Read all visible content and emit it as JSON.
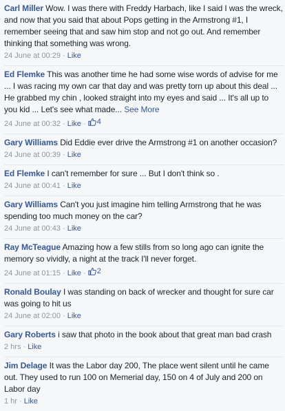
{
  "comments": [
    {
      "author": "Carl Miller",
      "text": "Wow. I was there with Freddy Harbach, like I said I was the wreck, and now that you said that about Pops getting in the Armstrong #1, I remember seeing that and saw him stop and not go out. And remember thinking that something was wrong.",
      "time": "24 June at 00:29",
      "like_label": "Like"
    },
    {
      "author": "Ed Flemke",
      "text": "This was another time he had some wise words of advise for me ... I was racing my own car that day and was pretty torn up about this deal ... He grabbed my chin , looked straight into my eyes and said ... It's all up to you kid ... Let's see what made...",
      "see_more": "See More",
      "time": "24 June at 00:32",
      "like_label": "Like",
      "likes": "4"
    },
    {
      "author": "Gary Williams",
      "text": "Did Eddie ever drive the Armstrong #1 on another occasion?",
      "time": "24 June at 00:39",
      "like_label": "Like"
    },
    {
      "author": "Ed Flemke",
      "text": "I can't remember for sure ... But I don't think so .",
      "time": "24 June at 00:41",
      "like_label": "Like"
    },
    {
      "author": "Gary Williams",
      "text": "Can't you just imagine him telling Armstrong that he was spending too much money on the car?",
      "time": "24 June at 00:43",
      "like_label": "Like"
    },
    {
      "author": "Ray McTeague",
      "text": "Amazing how a few stills from so long ago can ignite the memory so vividly, a night at the track I'll never forget.",
      "time": "24 June at 01:15",
      "like_label": "Like",
      "likes": "2"
    },
    {
      "author": "Ronald Boulay",
      "text": "I was standing on back of wrecker and thought for sure car was going to hit us",
      "time": "24 June at 02:00",
      "like_label": "Like"
    },
    {
      "author": "Gary Roberts",
      "text": "i saw that photo in the book about that great man bad crash",
      "time": "2 hrs",
      "like_label": "Like"
    },
    {
      "author": "Jim Delage",
      "text": "It was the Labor day 200, The place went silent until he came out. They used to run 100 on Memerial day, 150 on 4 of July and 200 on Labor day",
      "time": "1 hr",
      "like_label": "Like"
    }
  ],
  "separator": " · ",
  "colors": {
    "link": "#365899",
    "meta": "#90949c",
    "text": "#1d2129",
    "background": "#f6f7f9"
  }
}
